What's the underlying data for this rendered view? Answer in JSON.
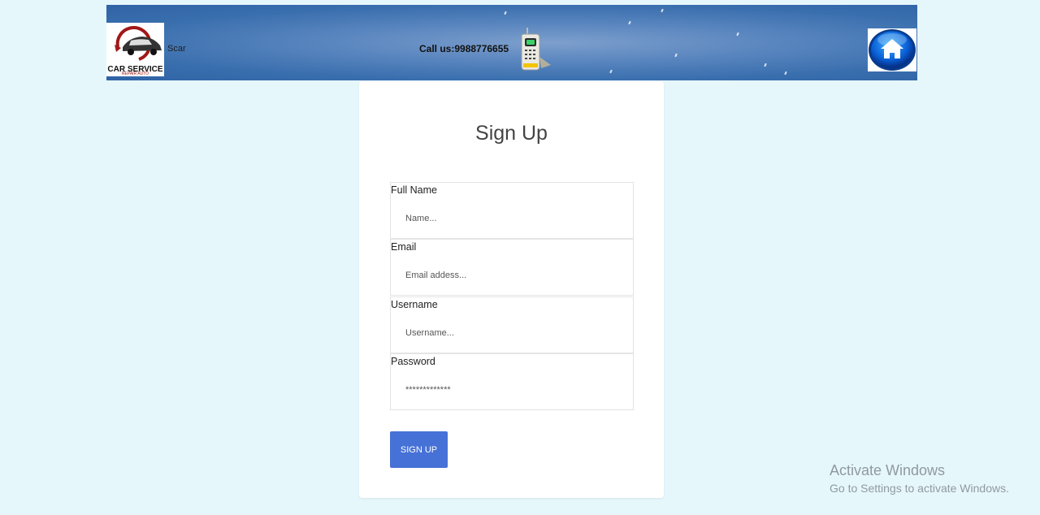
{
  "header": {
    "logo": {
      "text": "CAR SERVICE",
      "subtext": "REPAIR AUTO"
    },
    "brand_name": "Scar",
    "call_label": "Call us:9988776655",
    "phone_icon": "mobile-phone-icon",
    "home_icon": "home-icon"
  },
  "form": {
    "title": "Sign Up",
    "fields": [
      {
        "label": "Full Name",
        "placeholder": "Name..."
      },
      {
        "label": "Email",
        "placeholder": "Email addess..."
      },
      {
        "label": "Username",
        "placeholder": "Username..."
      },
      {
        "label": "Password",
        "placeholder": "*************"
      }
    ],
    "submit_label": "SIGN UP"
  },
  "watermark": {
    "title": "Activate Windows",
    "subtitle": "Go to Settings to activate Windows."
  },
  "colors": {
    "page_bg": "#e6f7fc",
    "button_bg": "#4671d6",
    "header_bg": "#3a6fae"
  }
}
